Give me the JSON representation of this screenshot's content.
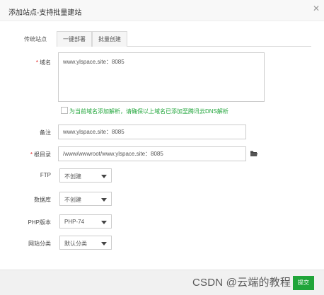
{
  "dialog": {
    "title": "添加站点-支持批量建站"
  },
  "tabs": [
    {
      "label": "传统站点"
    },
    {
      "label": "一键部署"
    },
    {
      "label": "批量创建"
    }
  ],
  "form": {
    "domain": {
      "label": "域名",
      "value": "www.ylspace.site：8085"
    },
    "dns": {
      "label": "为当前域名添加解析，请确保以上域名已添加至腾讯云DNS解析",
      "checked": false
    },
    "remark": {
      "label": "备注",
      "value": "www.ylspace.site：8085"
    },
    "root": {
      "label": "根目录",
      "value": "/www/wwwroot/www.ylspace.site：8085"
    },
    "ftp": {
      "label": "FTP",
      "value": "不创建"
    },
    "database": {
      "label": "数据库",
      "value": "不创建"
    },
    "php": {
      "label": "PHP版本",
      "value": "PHP-74"
    },
    "category": {
      "label": "网站分类",
      "value": "默认分类"
    }
  },
  "footer": {
    "submit_label": "提交"
  },
  "watermark": {
    "text": "CSDN @云端的教程"
  },
  "colors": {
    "accent": "#20a53a",
    "required": "#e02020"
  }
}
